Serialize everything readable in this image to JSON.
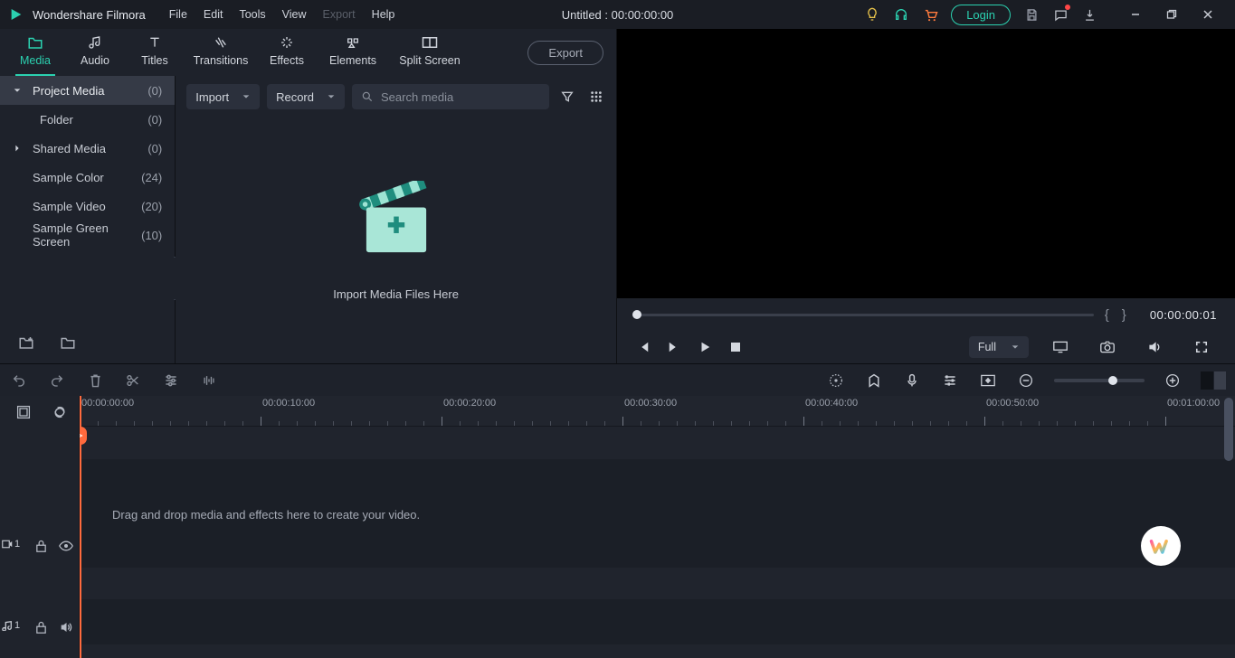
{
  "app": {
    "title": "Wondershare Filmora",
    "project": "Untitled : 00:00:00:00",
    "login": "Login"
  },
  "menu": {
    "file": "File",
    "edit": "Edit",
    "tools": "Tools",
    "view": "View",
    "export": "Export",
    "help": "Help"
  },
  "tabs": {
    "media": "Media",
    "audio": "Audio",
    "titles": "Titles",
    "transitions": "Transitions",
    "effects": "Effects",
    "elements": "Elements",
    "split": "Split Screen",
    "export_btn": "Export"
  },
  "sidebar": {
    "items": [
      {
        "label": "Project Media",
        "count": "(0)"
      },
      {
        "label": "Folder",
        "count": "(0)"
      },
      {
        "label": "Shared Media",
        "count": "(0)"
      },
      {
        "label": "Sample Color",
        "count": "(24)"
      },
      {
        "label": "Sample Video",
        "count": "(20)"
      },
      {
        "label": "Sample Green Screen",
        "count": "(10)"
      }
    ]
  },
  "media_toolbar": {
    "import": "Import",
    "record": "Record",
    "search_placeholder": "Search media"
  },
  "import_area": {
    "text": "Import Media Files Here"
  },
  "preview": {
    "timecode": "00:00:00:01",
    "quality": "Full"
  },
  "timeline": {
    "ruler": [
      "00:00:00:00",
      "00:00:10:00",
      "00:00:20:00",
      "00:00:30:00",
      "00:00:40:00",
      "00:00:50:00",
      "00:01:00:00"
    ],
    "drop_hint": "Drag and drop media and effects here to create your video.",
    "v1": "1",
    "a1": "1"
  }
}
